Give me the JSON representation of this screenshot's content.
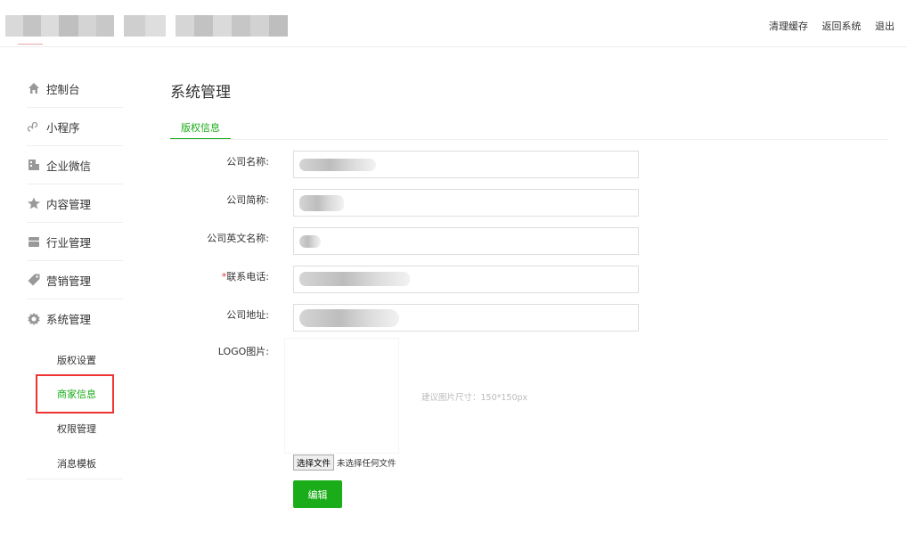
{
  "header": {
    "links": [
      "清理缓存",
      "返回系统",
      "退出"
    ]
  },
  "sidebar": {
    "menu": [
      {
        "label": "控制台",
        "icon": "home-icon"
      },
      {
        "label": "小程序",
        "icon": "mini-program-icon"
      },
      {
        "label": "企业微信",
        "icon": "enterprise-wechat-icon"
      },
      {
        "label": "内容管理",
        "icon": "content-icon"
      },
      {
        "label": "行业管理",
        "icon": "industry-icon"
      },
      {
        "label": "营销管理",
        "icon": "tag-icon"
      },
      {
        "label": "系统管理",
        "icon": "gear-icon"
      }
    ],
    "submenu": [
      "版权设置",
      "商家信息",
      "权限管理",
      "消息模板"
    ],
    "active_submenu": "商家信息"
  },
  "main": {
    "title": "系统管理",
    "tab": "版权信息",
    "form": {
      "company_name_label": "公司名称:",
      "company_short_label": "公司简称:",
      "company_en_label": "公司英文名称:",
      "phone_required_mark": "*",
      "phone_label": "联系电话:",
      "address_label": "公司地址:",
      "logo_label": "LOGO图片:",
      "logo_hint": "建议图片尺寸：150*150px",
      "file_button": "选择文件",
      "file_status": "未选择任何文件",
      "submit_button": "编辑"
    }
  },
  "colors": {
    "accent": "#1aad19",
    "required": "#e33333",
    "highlight": "#e33333"
  }
}
